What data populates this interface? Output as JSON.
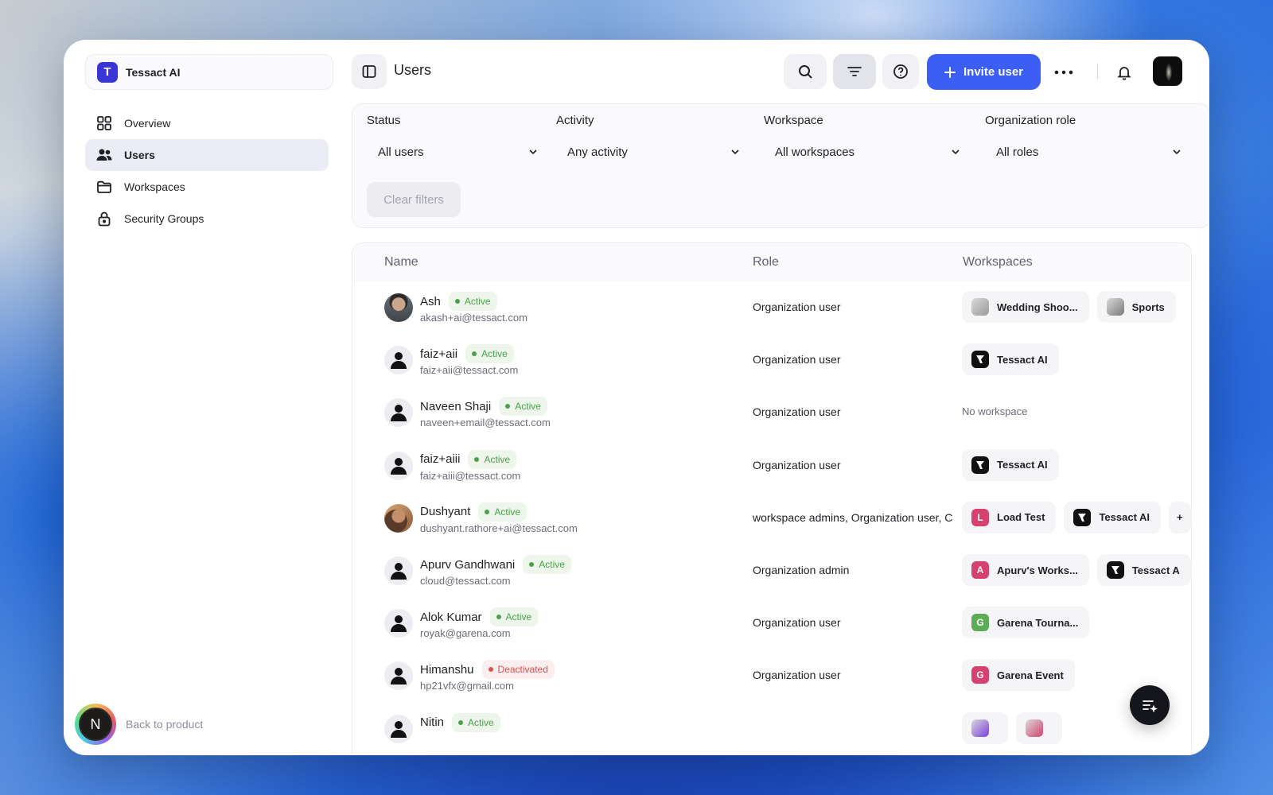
{
  "org": {
    "logo_letter": "T",
    "name": "Tessact AI",
    "color": "#3a36d6"
  },
  "sidebar": {
    "items": [
      {
        "label": "Overview",
        "icon": "grid-icon",
        "active": false
      },
      {
        "label": "Users",
        "icon": "users-icon",
        "active": true
      },
      {
        "label": "Workspaces",
        "icon": "folder-icon",
        "active": false
      },
      {
        "label": "Security Groups",
        "icon": "lock-icon",
        "active": false
      }
    ],
    "back": {
      "avatar_letter": "N",
      "label": "Back to product"
    }
  },
  "header": {
    "title": "Users",
    "invite_label": "Invite user",
    "accent": "#3d5ef5"
  },
  "filters": {
    "status": {
      "label": "Status",
      "value": "All users"
    },
    "activity": {
      "label": "Activity",
      "value": "Any activity"
    },
    "workspace": {
      "label": "Workspace",
      "value": "All workspaces"
    },
    "org_role": {
      "label": "Organization role",
      "value": "All roles"
    },
    "clear_label": "Clear filters"
  },
  "table": {
    "columns": [
      "Name",
      "Role",
      "Workspaces"
    ],
    "rows": [
      {
        "name": "Ash",
        "status": "Active",
        "email": "akash+ai@tessact.com",
        "role": "Organization user",
        "avatar": "photo1",
        "workspaces": [
          {
            "label": "Wedding Shoo...",
            "letter": "",
            "color": "#9a9a9a"
          },
          {
            "label": "Sports",
            "letter": "",
            "color": "#7a7a7a"
          }
        ]
      },
      {
        "name": "faiz+aii",
        "status": "Active",
        "email": "faiz+aii@tessact.com",
        "role": "Organization user",
        "avatar": "default",
        "workspaces": [
          {
            "label": "Tessact AI",
            "letter": "",
            "color": "#111111"
          }
        ]
      },
      {
        "name": "Naveen Shaji",
        "status": "Active",
        "email": "naveen+email@tessact.com",
        "role": "Organization user",
        "avatar": "default",
        "workspaces": [],
        "no_workspace": "No workspace"
      },
      {
        "name": "faiz+aiii",
        "status": "Active",
        "email": "faiz+aiii@tessact.com",
        "role": "Organization user",
        "avatar": "default",
        "workspaces": [
          {
            "label": "Tessact AI",
            "letter": "",
            "color": "#111111"
          }
        ]
      },
      {
        "name": "Dushyant",
        "status": "Active",
        "email": "dushyant.rathore+ai@tessact.com",
        "role": "workspace admins, Organization user, C",
        "avatar": "photo2",
        "workspaces": [
          {
            "label": "Load Test",
            "letter": "L",
            "color": "#d6416f"
          },
          {
            "label": "Tessact AI",
            "letter": "",
            "color": "#111111"
          },
          {
            "label": "+",
            "letter": "",
            "color": "#f5f5f8"
          }
        ]
      },
      {
        "name": "Apurv Gandhwani",
        "status": "Active",
        "email": "cloud@tessact.com",
        "role": "Organization admin",
        "avatar": "default",
        "workspaces": [
          {
            "label": "Apurv's Works...",
            "letter": "A",
            "color": "#d6416f"
          },
          {
            "label": "Tessact A",
            "letter": "",
            "color": "#111111"
          }
        ]
      },
      {
        "name": "Alok Kumar",
        "status": "Active",
        "email": "royak@garena.com",
        "role": "Organization user",
        "avatar": "default",
        "workspaces": [
          {
            "label": "Garena Tourna...",
            "letter": "G",
            "color": "#5cac55"
          }
        ]
      },
      {
        "name": "Himanshu",
        "status": "Deactivated",
        "email": "hp21vfx@gmail.com",
        "role": "Organization user",
        "avatar": "default",
        "workspaces": [
          {
            "label": "Garena Event",
            "letter": "G",
            "color": "#d6416f"
          }
        ]
      },
      {
        "name": "Nitin",
        "status": "Active",
        "email": "",
        "role": "",
        "avatar": "default",
        "workspaces": [
          {
            "label": "",
            "letter": "",
            "color": "#7b3fe0"
          },
          {
            "label": "",
            "letter": "",
            "color": "#d6416f"
          }
        ]
      }
    ]
  }
}
